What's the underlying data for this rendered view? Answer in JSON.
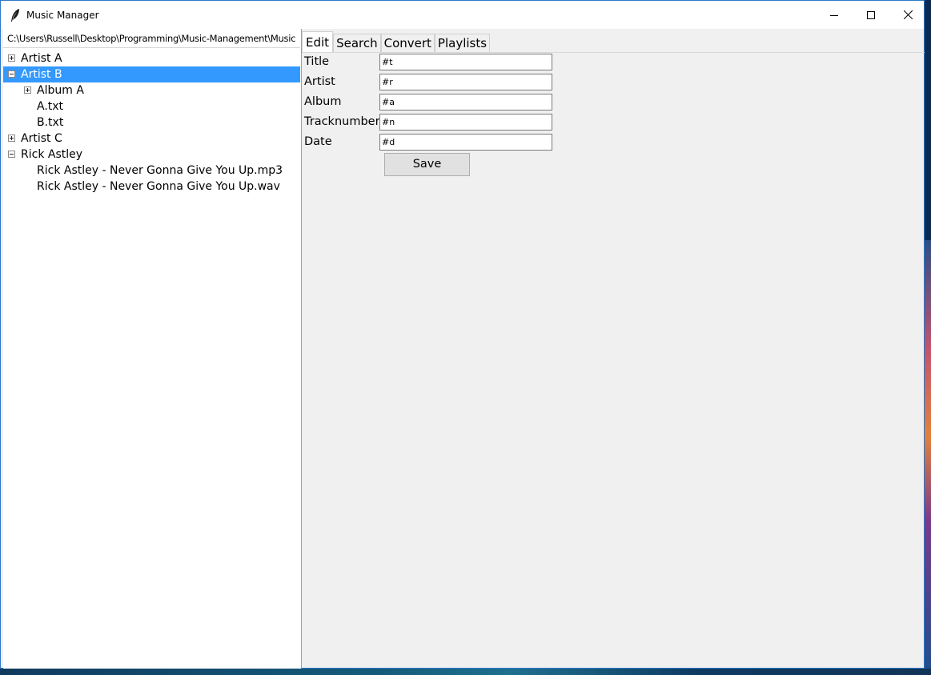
{
  "window": {
    "title": "Music Manager"
  },
  "browser": {
    "path": "C:\\Users\\Russell\\Desktop\\Programming\\Music-Management\\Music",
    "tree": [
      {
        "label": "Artist A",
        "toggle": "expand",
        "selected": false
      },
      {
        "label": "Artist B",
        "toggle": "collapse",
        "selected": true
      },
      {
        "label": "Album A",
        "toggle": "expand",
        "selected": false
      },
      {
        "label": "A.txt",
        "toggle": "none",
        "selected": false
      },
      {
        "label": "B.txt",
        "toggle": "none",
        "selected": false
      },
      {
        "label": "Artist C",
        "toggle": "expand",
        "selected": false
      },
      {
        "label": "Rick Astley",
        "toggle": "collapse",
        "selected": false
      },
      {
        "label": "Rick Astley - Never Gonna Give You Up.mp3",
        "toggle": "none",
        "selected": false
      },
      {
        "label": "Rick Astley - Never Gonna Give You Up.wav",
        "toggle": "none",
        "selected": false
      }
    ]
  },
  "tabs": [
    "Edit",
    "Search",
    "Convert",
    "Playlists"
  ],
  "active_tab": "Edit",
  "edit_form": {
    "fields": [
      {
        "label": "Title",
        "value": "#t"
      },
      {
        "label": "Artist",
        "value": "#r"
      },
      {
        "label": "Album",
        "value": "#a"
      },
      {
        "label": "Tracknumber",
        "value": "#n"
      },
      {
        "label": "Date",
        "value": "#d"
      }
    ],
    "save_label": "Save"
  },
  "colors": {
    "selection": "#3399ff",
    "window_border": "#2b78c5",
    "panel_bg": "#f0f0f0"
  }
}
